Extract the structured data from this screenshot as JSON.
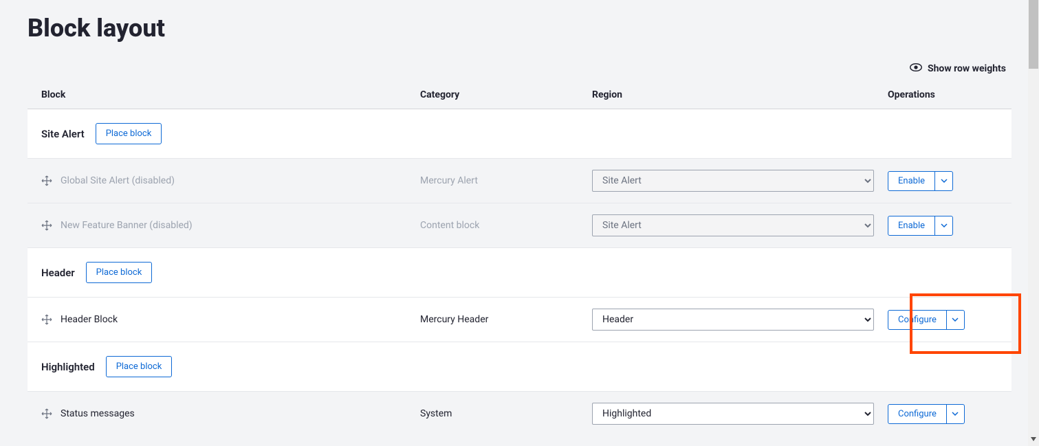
{
  "page_title": "Block layout",
  "show_weights_label": "Show row weights",
  "columns": {
    "block": "Block",
    "category": "Category",
    "region": "Region",
    "operations": "Operations"
  },
  "place_block_label": "Place block",
  "regions": {
    "site_alert": "Site Alert",
    "header": "Header",
    "highlighted": "Highlighted"
  },
  "blocks": {
    "global_alert": {
      "name": "Global Site Alert (disabled)",
      "category": "Mercury Alert",
      "region": "Site Alert",
      "op": "Enable"
    },
    "new_feature": {
      "name": "New Feature Banner (disabled)",
      "category": "Content block",
      "region": "Site Alert",
      "op": "Enable"
    },
    "header_block": {
      "name": "Header Block",
      "category": "Mercury Header",
      "region": "Header",
      "op": "Configure"
    },
    "status_msgs": {
      "name": "Status messages",
      "category": "System",
      "region": "Highlighted",
      "op": "Configure"
    }
  }
}
